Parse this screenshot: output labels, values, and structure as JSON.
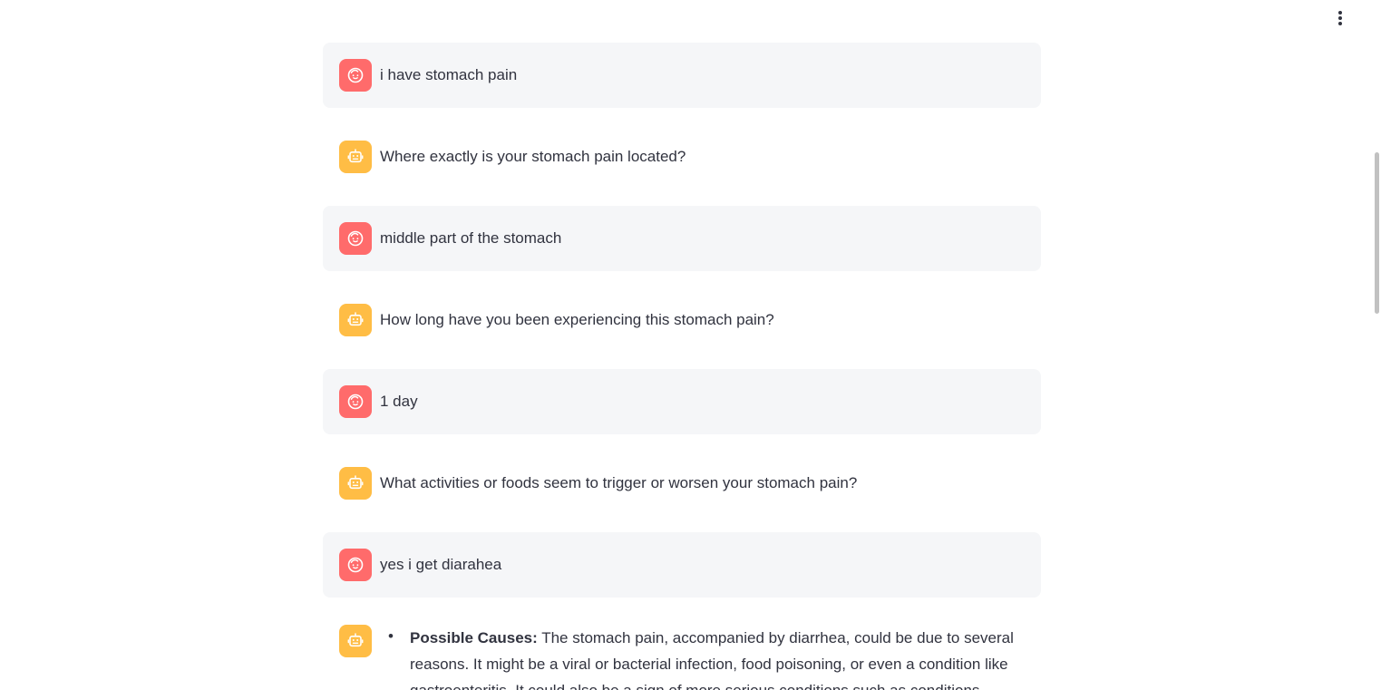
{
  "menu": {
    "icon": "vertical-ellipsis-icon"
  },
  "colors": {
    "user_avatar": "#ff6b6b",
    "assistant_avatar": "#ffbd45",
    "user_bubble": "#f5f6f8",
    "text": "#31333f"
  },
  "messages": [
    {
      "role": "user",
      "icon": "user-face-icon",
      "text": "i have stomach pain"
    },
    {
      "role": "assistant",
      "icon": "robot-icon",
      "text": "Where exactly is your stomach pain located?"
    },
    {
      "role": "user",
      "icon": "user-face-icon",
      "text": "middle part of the stomach"
    },
    {
      "role": "assistant",
      "icon": "robot-icon",
      "text": "How long have you been experiencing this stomach pain?"
    },
    {
      "role": "user",
      "icon": "user-face-icon",
      "text": "1 day"
    },
    {
      "role": "assistant",
      "icon": "robot-icon",
      "text": "What activities or foods seem to trigger or worsen your stomach pain?"
    },
    {
      "role": "user",
      "icon": "user-face-icon",
      "text": "yes i get diarahea"
    }
  ],
  "final_response": {
    "role": "assistant",
    "icon": "robot-icon",
    "bullet_title": "Possible Causes:",
    "bullet_text": "The stomach pain, accompanied by diarrhea, could be due to several reasons. It might be a viral or bacterial infection, food poisoning, or even a condition like gastroenteritis. It could also be a sign of more serious conditions such as conditions"
  }
}
